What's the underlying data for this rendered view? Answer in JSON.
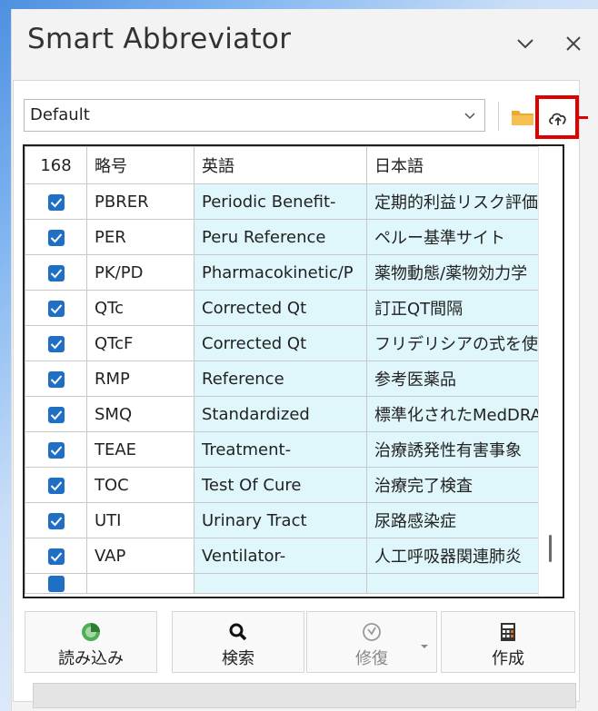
{
  "window": {
    "title": "Smart Abbreviator"
  },
  "toolbar": {
    "profile_selected": "Default"
  },
  "table": {
    "count": "168",
    "headers": [
      "略号",
      "英語",
      "日本語"
    ],
    "rows": [
      {
        "checked": true,
        "abbr": "PBRER",
        "en": "Periodic Benefit-",
        "ja": "定期的利益リスク評価"
      },
      {
        "checked": true,
        "abbr": "PER",
        "en": "Peru Reference",
        "ja": "ペルー基準サイト"
      },
      {
        "checked": true,
        "abbr": "PK/PD",
        "en": "Pharmacokinetic/P",
        "ja": "薬物動態/薬物効力学"
      },
      {
        "checked": true,
        "abbr": "QTc",
        "en": "Corrected Qt",
        "ja": "訂正QT間隔"
      },
      {
        "checked": true,
        "abbr": "QTcF",
        "en": "Corrected Qt",
        "ja": "フリデリシアの式を使用"
      },
      {
        "checked": true,
        "abbr": "RMP",
        "en": "Reference",
        "ja": "参考医薬品"
      },
      {
        "checked": true,
        "abbr": "SMQ",
        "en": "Standardized",
        "ja": "標準化されたMedDRA"
      },
      {
        "checked": true,
        "abbr": "TEAE",
        "en": "Treatment-",
        "ja": "治療誘発性有害事象"
      },
      {
        "checked": true,
        "abbr": "TOC",
        "en": "Test Of Cure",
        "ja": "治療完了検査"
      },
      {
        "checked": true,
        "abbr": "UTI",
        "en": "Urinary Tract",
        "ja": "尿路感染症"
      },
      {
        "checked": true,
        "abbr": "VAP",
        "en": "Ventilator-",
        "ja": "人工呼吸器関連肺炎"
      }
    ]
  },
  "buttons": {
    "load": "読み込み",
    "search": "検索",
    "repair": "修復",
    "create": "作成"
  },
  "colors": {
    "accent": "#1f6fc5",
    "highlight": "#e00000",
    "cell_bg": "#dff6fb"
  }
}
